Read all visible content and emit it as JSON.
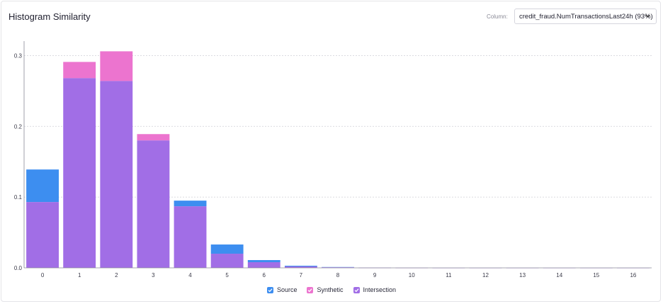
{
  "header": {
    "title": "Histogram Similarity",
    "column_label": "Column:",
    "column_value": "credit_fraud.NumTransactionsLast24h (93%)"
  },
  "colors": {
    "source": "#3d8ef0",
    "synthetic": "#ec74cf",
    "intersection": "#a16ee6",
    "grid": "#cfcfd6",
    "axis": "#8a8a96"
  },
  "legend": [
    {
      "name": "Source",
      "color": "#3d8ef0",
      "checked": true
    },
    {
      "name": "Synthetic",
      "color": "#ec74cf",
      "checked": true
    },
    {
      "name": "Intersection",
      "color": "#a16ee6",
      "checked": true
    }
  ],
  "chart_data": {
    "type": "bar",
    "categories": [
      "0",
      "1",
      "2",
      "3",
      "4",
      "5",
      "6",
      "7",
      "8",
      "9",
      "10",
      "11",
      "12",
      "13",
      "14",
      "15",
      "16"
    ],
    "series": [
      {
        "name": "Source",
        "values": [
          0.139,
          0.268,
          0.264,
          0.18,
          0.095,
          0.033,
          0.011,
          0.003,
          0.0012,
          0.0004,
          0.0002,
          0.0001,
          0.0001,
          0.0001,
          0.0001,
          0.0001,
          0.0001
        ]
      },
      {
        "name": "Synthetic",
        "values": [
          0.093,
          0.291,
          0.306,
          0.189,
          0.087,
          0.02,
          0.008,
          0.002,
          0.0008,
          0.0003,
          0.0002,
          0.0001,
          0.0001,
          0.0001,
          0.0001,
          0.0001,
          0.0001
        ]
      }
    ],
    "y_ticks": [
      "0.0",
      "0.1",
      "0.2",
      "0.3"
    ],
    "ylim": [
      0,
      0.3
    ],
    "grid": true,
    "legend_position": "bottom-center"
  }
}
